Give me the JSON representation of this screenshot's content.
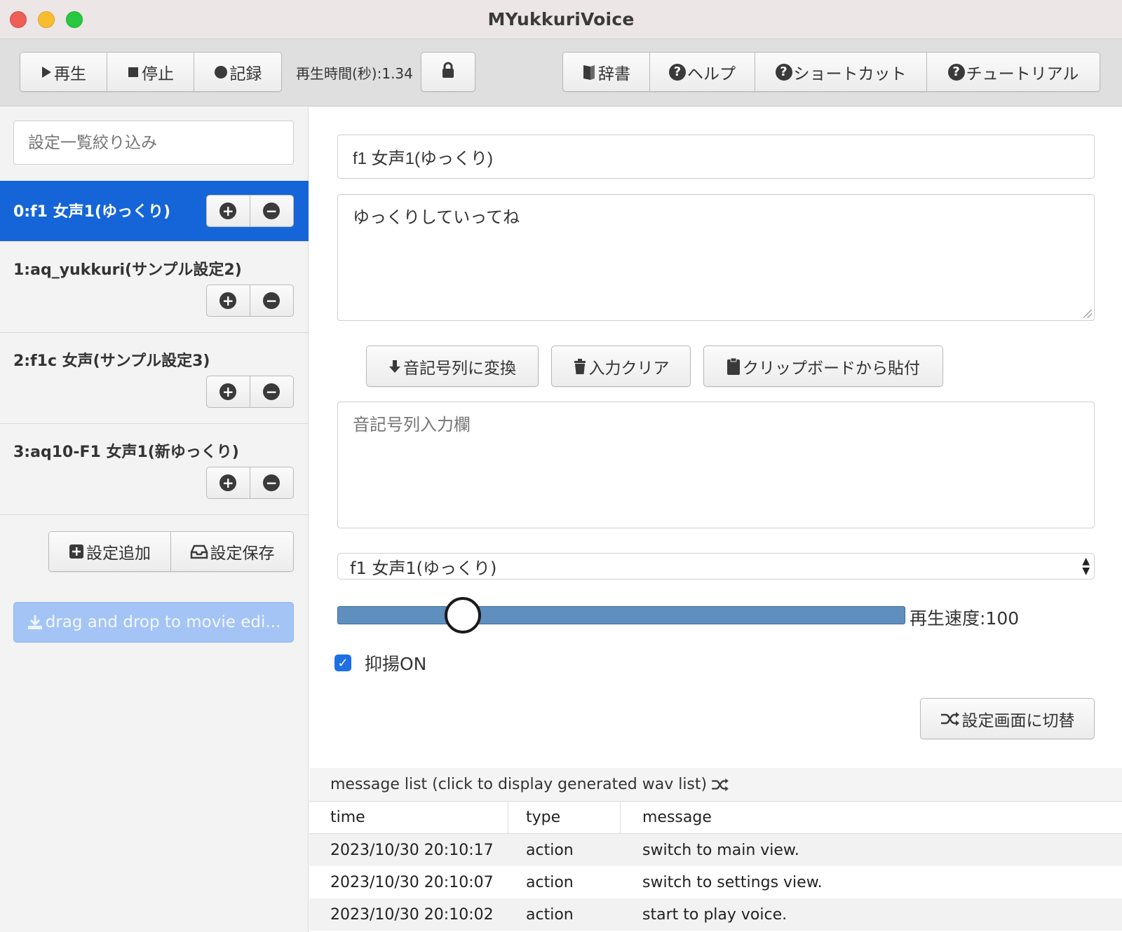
{
  "window": {
    "title": "MYukkuriVoice"
  },
  "toolbar": {
    "play_label": "再生",
    "stop_label": "停止",
    "record_label": "記録",
    "play_time": "再生時間(秒):1.34",
    "dictionary_label": "辞書",
    "help_label": "ヘルプ",
    "shortcut_label": "ショートカット",
    "tutorial_label": "チュートリアル"
  },
  "sidebar": {
    "filter_placeholder": "設定一覧絞り込み",
    "items": [
      {
        "label": "0:f1 女声1(ゆっくり)"
      },
      {
        "label": "1:aq_yukkuri(サンプル設定2)"
      },
      {
        "label": "2:f1c 女声(サンプル設定3)"
      },
      {
        "label": "3:aq10-F1 女声1(新ゆっくり)"
      }
    ],
    "add_setting_label": "設定追加",
    "save_setting_label": "設定保存",
    "drag_label": "drag and drop to movie edi..."
  },
  "main": {
    "voice_name_value": "f1 女声1(ゆっくり)",
    "text_value": "ゆっくりしていってね",
    "convert_label": "音記号列に変換",
    "clear_label": "入力クリア",
    "paste_label": "クリップボードから貼付",
    "phonetic_placeholder": "音記号列入力欄",
    "voice_select_value": "f1 女声1(ゆっくり)",
    "speed_label": "再生速度:100",
    "speed_level": 0.22,
    "intonation_label": "抑揚ON",
    "intonation_checked": true,
    "switch_label": "設定画面に切替"
  },
  "messages": {
    "header": "message list (click to display generated wav list)",
    "columns": [
      "time",
      "type",
      "message"
    ],
    "rows": [
      {
        "time": "2023/10/30 20:10:17",
        "type": "action",
        "message": "switch to main view."
      },
      {
        "time": "2023/10/30 20:10:07",
        "type": "action",
        "message": "switch to settings view."
      },
      {
        "time": "2023/10/30 20:10:02",
        "type": "action",
        "message": "start to play voice."
      }
    ]
  },
  "colors": {
    "accent": "#1565d8",
    "slider": "#5f8fbf",
    "drag_button": "#a3c4f5"
  }
}
